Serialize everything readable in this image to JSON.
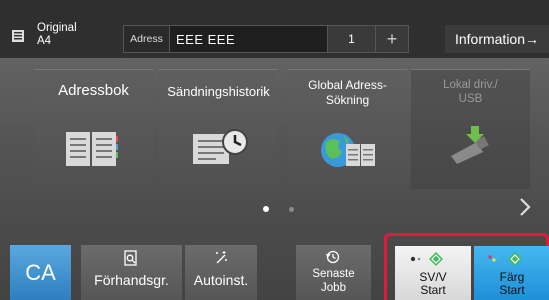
{
  "header": {
    "original_label": "Original",
    "original_size": "A4",
    "address_label": "Adress",
    "address_value": "EEE EEE",
    "address_count": "1",
    "plus_label": "+",
    "info_label": "Information→"
  },
  "tiles": [
    {
      "label": "Adressbok",
      "enabled": true
    },
    {
      "label": "Sändningshistorik",
      "enabled": true
    },
    {
      "label_line1": "Global Adress-",
      "label_line2": "Sökning",
      "enabled": true
    },
    {
      "label_line1": "Lokal driv./",
      "label_line2": "USB",
      "enabled": false
    }
  ],
  "pagination": {
    "current": 1,
    "total": 2
  },
  "bottom": {
    "ca_label": "CA",
    "preview_label": "Förhandsgr.",
    "auto_label": "Autoinst.",
    "recent_line1": "Senaste",
    "recent_line2": "Jobb",
    "bw_line1": "SV/V",
    "bw_line2": "Start",
    "color_line1": "Färg",
    "color_line2": "Start"
  },
  "colors": {
    "ca_blue": "#2d7fc0",
    "color_start_blue": "#1e8fd8",
    "highlight_red": "#e3193b",
    "start_green": "#3cbf5a"
  }
}
